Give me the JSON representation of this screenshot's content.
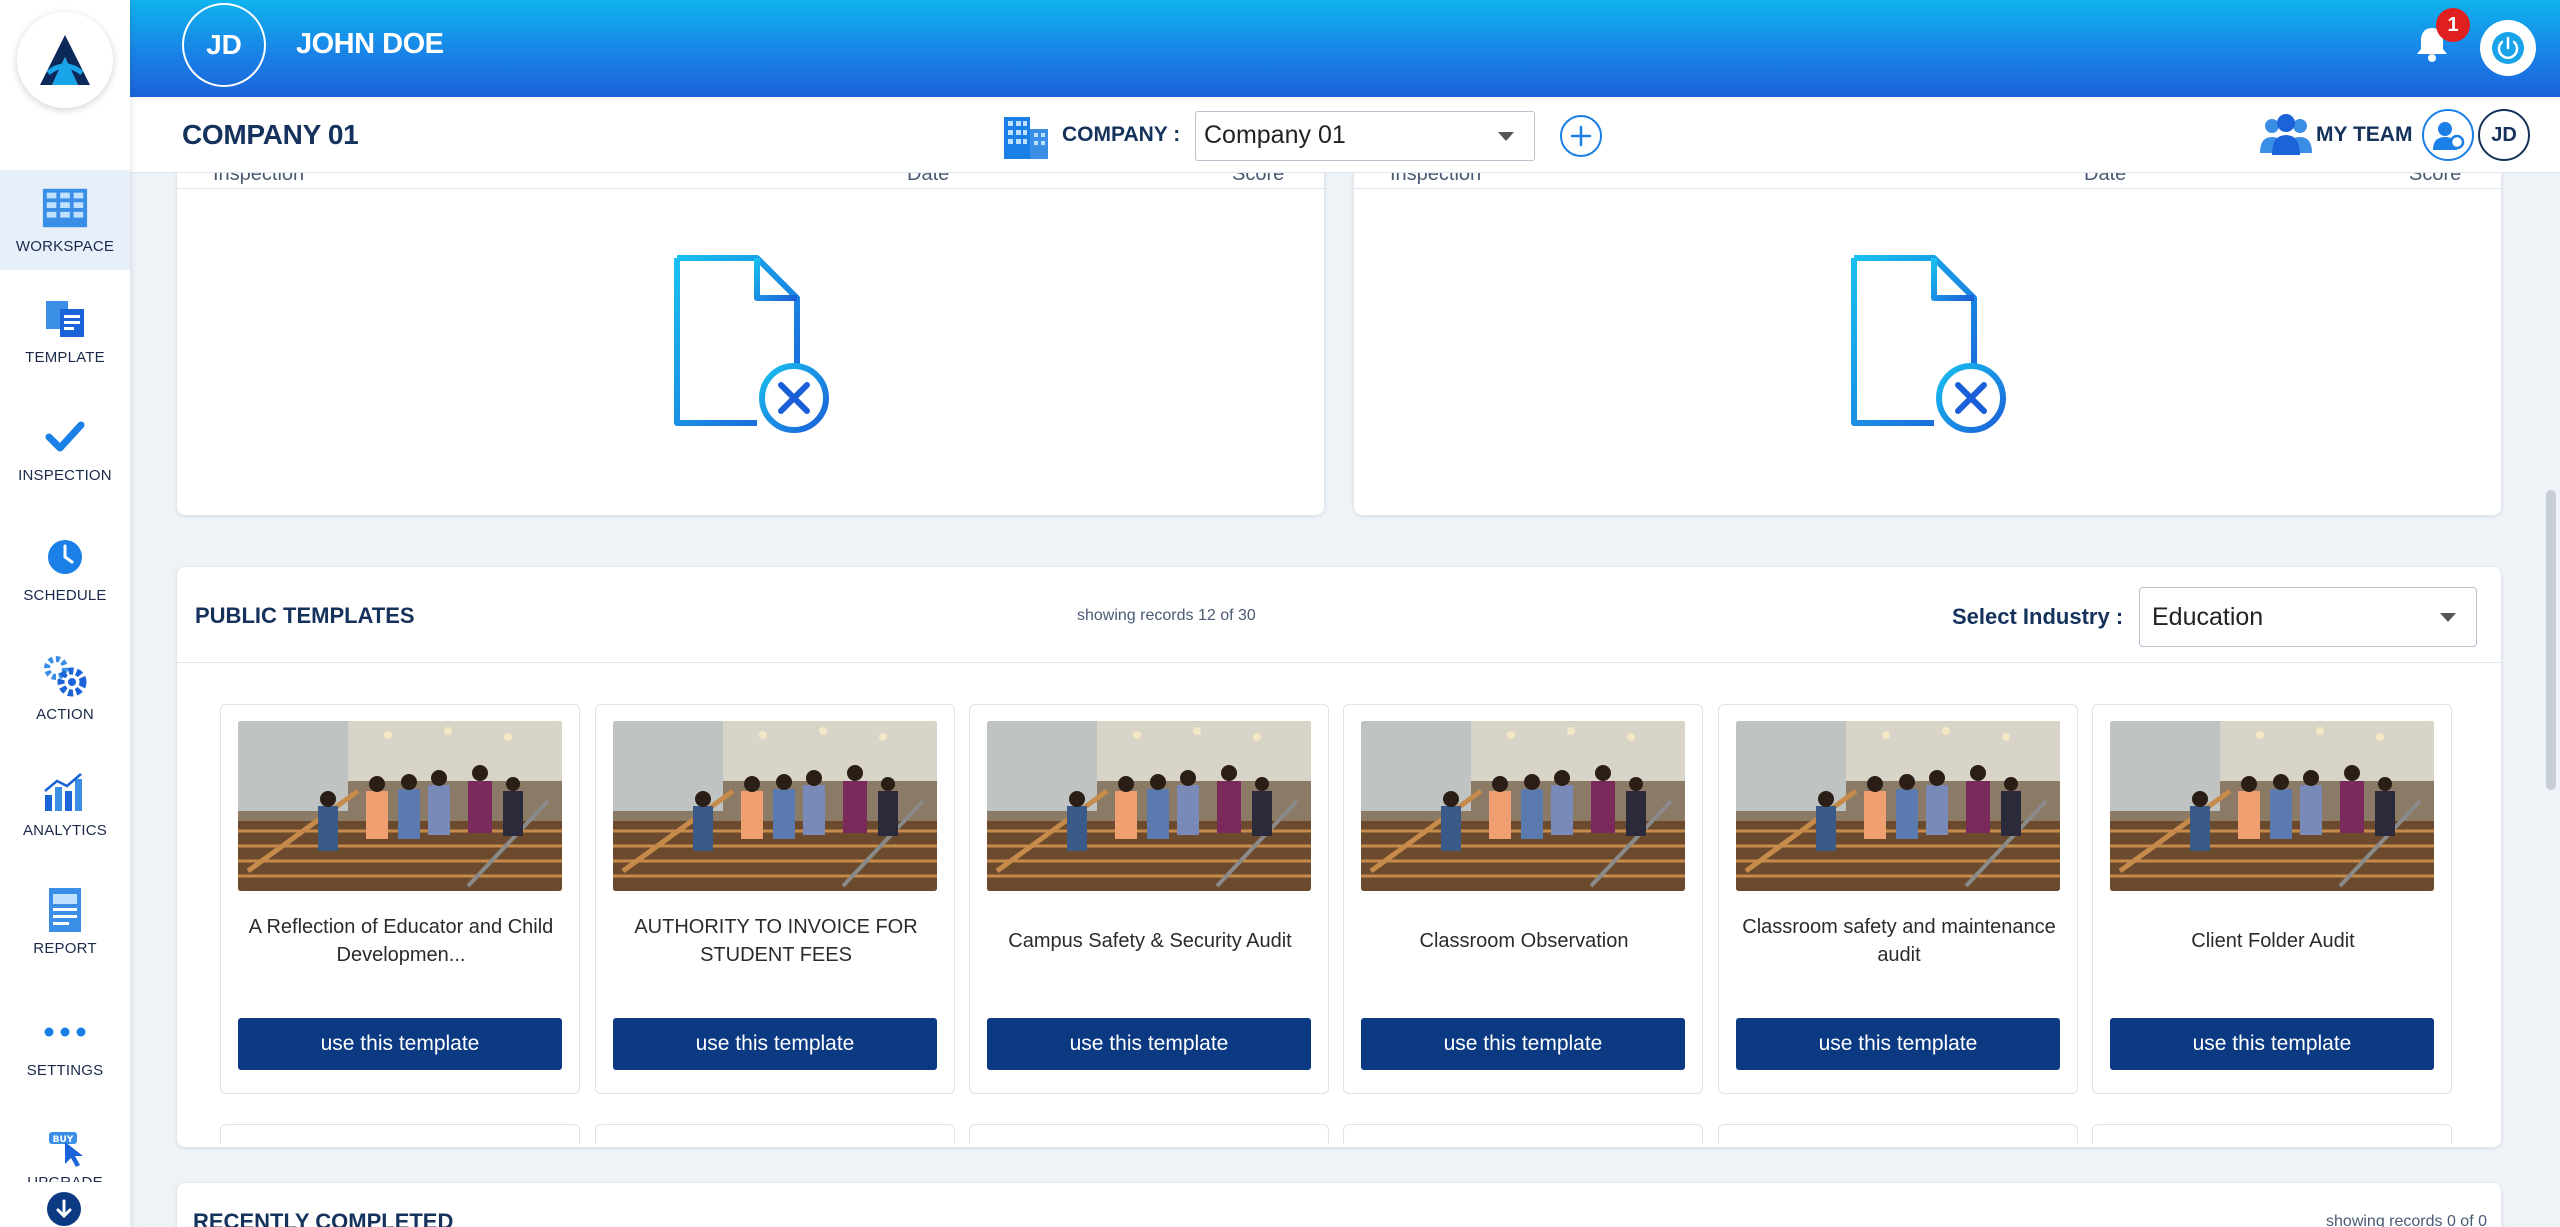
{
  "app": {
    "user_initials": "JD",
    "user_name": "JOHN DOE",
    "notification_count": "1"
  },
  "sidebar": {
    "items": [
      {
        "label": "WORKSPACE",
        "icon": "workspace-icon"
      },
      {
        "label": "TEMPLATE",
        "icon": "template-icon"
      },
      {
        "label": "INSPECTION",
        "icon": "checkmark-icon"
      },
      {
        "label": "SCHEDULE",
        "icon": "clock-icon"
      },
      {
        "label": "ACTION",
        "icon": "gears-icon"
      },
      {
        "label": "ANALYTICS",
        "icon": "bar-chart-icon"
      },
      {
        "label": "REPORT",
        "icon": "report-icon"
      },
      {
        "label": "SETTINGS",
        "icon": "dots-icon"
      },
      {
        "label": "UPGRADE",
        "icon": "buy-cursor-icon"
      }
    ]
  },
  "subheader": {
    "company_title": "COMPANY 01",
    "company_label": "COMPANY :",
    "company_selected": "Company 01",
    "team_label": "MY TEAM",
    "team_member_initials": "JD"
  },
  "top_panels": {
    "left": {
      "col1": "Inspection",
      "col2": "Date",
      "col3": "Score"
    },
    "right": {
      "col1": "Inspection",
      "col2": "Date",
      "col3": "Score"
    }
  },
  "public_templates": {
    "title": "PUBLIC TEMPLATES",
    "count_text": "showing records 12 of 30",
    "industry_label": "Select Industry :",
    "industry_selected": "Education",
    "cards": [
      {
        "title": "A Reflection of Educator and Child Developmen...",
        "button": "use this template"
      },
      {
        "title": "AUTHORITY TO INVOICE FOR STUDENT FEES",
        "button": "use this template"
      },
      {
        "title": "Campus Safety & Security Audit",
        "button": "use this template"
      },
      {
        "title": "Classroom Observation",
        "button": "use this template"
      },
      {
        "title": "Classroom safety and maintenance audit",
        "button": "use this template"
      },
      {
        "title": "Client Folder Audit",
        "button": "use this template"
      }
    ]
  },
  "recently_completed": {
    "title": "RECENTLY COMPLETED",
    "count_text": "showing records 0 of 0"
  },
  "colors": {
    "header_top": "#0fb3ee",
    "header_bottom": "#1a63d8",
    "navy": "#15325c",
    "button": "#0b3a82",
    "badge": "#e02020"
  }
}
